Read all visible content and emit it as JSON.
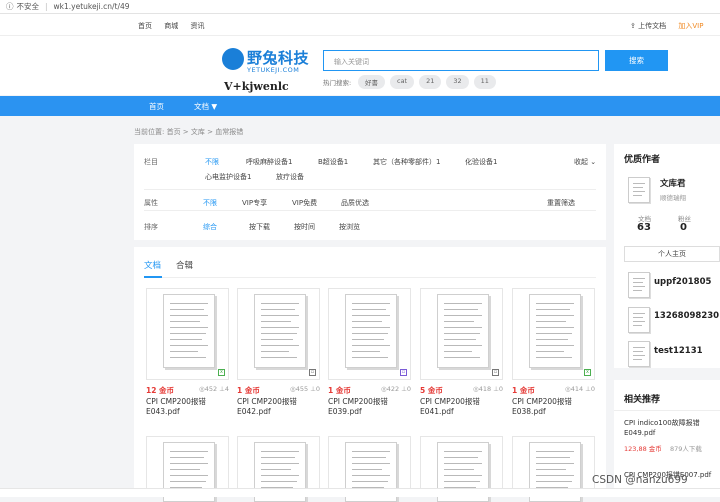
{
  "browser": {
    "security_label": "不安全",
    "url": "wk1.yetukeji.cn/t/49"
  },
  "topnav": {
    "items": [
      "首页",
      "商城",
      "资讯"
    ],
    "upload": "上传文档",
    "vip": "加入VIP"
  },
  "logo": {
    "name": "野兔科技",
    "sub": "YETUKEJI.COM"
  },
  "watermark": "V+kjwenlc",
  "search": {
    "placeholder": "输入关键词",
    "button": "搜索",
    "hot_label": "热门搜索:",
    "hot_tags": [
      "好書",
      "cat",
      "21",
      "32",
      "11"
    ]
  },
  "mainnav": {
    "home": "首页",
    "docs": "文档 ▼"
  },
  "breadcrumb": "当前位置: 首页 > 文库 > 血常报错",
  "filter": {
    "column": {
      "label": "栏目",
      "options": [
        "不限",
        "呼吸麻醉设备1",
        "B超设备1",
        "其它（各种零部件）1",
        "化验设备1",
        "心电监护设备1",
        "放疗设备"
      ],
      "collapse": "收起 ⌄"
    },
    "attribute": {
      "label": "属性",
      "options": [
        "不限",
        "VIP专享",
        "VIP免费",
        "品质优选"
      ],
      "reset": "重置筛选"
    },
    "sort": {
      "label": "排序",
      "options": [
        "综合",
        "按下载",
        "按时间",
        "按浏览"
      ]
    }
  },
  "tabs": {
    "docs": "文档",
    "collection": "合辑"
  },
  "cards": [
    {
      "price": "12 金币",
      "views": "◎452 ⊥4",
      "title": "CPI CMP200报错\nE043.pdf"
    },
    {
      "price": "1 金币",
      "views": "◎455 ⊥0",
      "title": "CPI CMP200报错\nE042.pdf"
    },
    {
      "price": "1 金币",
      "views": "◎422 ⊥0",
      "title": "CPI CMP200报错\nE039.pdf"
    },
    {
      "price": "5 金币",
      "views": "◎418 ⊥0",
      "title": "CPI CMP200报错\nE041.pdf"
    },
    {
      "price": "1 金币",
      "views": "◎414 ⊥0",
      "title": "CPI CMP200报错\nE038.pdf"
    }
  ],
  "authors": {
    "title": "优质作者",
    "featured": {
      "name": "文库君",
      "sub": "顺德瑞翔",
      "docs_label": "文档",
      "docs_value": "63",
      "fans_label": "粉丝",
      "fans_value": "0",
      "home_btn": "个人主页"
    },
    "list": [
      "uppf201805",
      "13268098230",
      "test12131"
    ]
  },
  "recommend": {
    "title": "相关推荐",
    "item1_title": "CPI indico100故障报错E049.pdf",
    "item1_price": "123,88 金币",
    "item1_downloads": "879人下载",
    "item2_title": "CPI CMP200报错E007.pdf"
  },
  "csdn": "CSDN @nanzu699"
}
